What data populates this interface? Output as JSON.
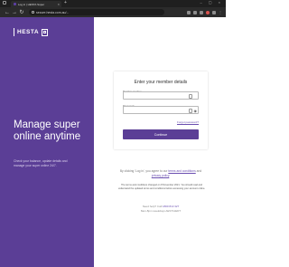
{
  "browser": {
    "tab_title": "Log in | HESTA Super",
    "tab_close": "×",
    "new_tab": "+",
    "window_controls": "– ▢ ×",
    "url": "secure.hesta.com.au/...",
    "nav": {
      "back": "←",
      "forward": "→",
      "reload": "↻"
    }
  },
  "brand": {
    "logo_text": "HESTA"
  },
  "hero": {
    "headline": "Manage super online anytime",
    "subtext": "Check your balance, update details and manage your super online 24/7."
  },
  "login": {
    "title": "Enter your member details",
    "member_label": "Member number",
    "password_label": "Password",
    "forgot": "Forgot password?",
    "submit": "Continue"
  },
  "terms": {
    "prefix": "By clicking 'Log in', you agree to our",
    "terms_link": "terms and conditions",
    "and": "and",
    "privacy_link": "privacy policy",
    "end": "."
  },
  "notice": "The terms and conditions changed on 8 November 2021. You should read and understand the updated terms and conditions before accessing your account online.",
  "help": {
    "line1_prefix": "Need help? Call",
    "phone": "1800 813 327",
    "line2": "8am-8pm weekdays AEST/AEDT"
  },
  "colors": {
    "brand_purple": "#5b3e96",
    "link": "#6b4fb0"
  }
}
